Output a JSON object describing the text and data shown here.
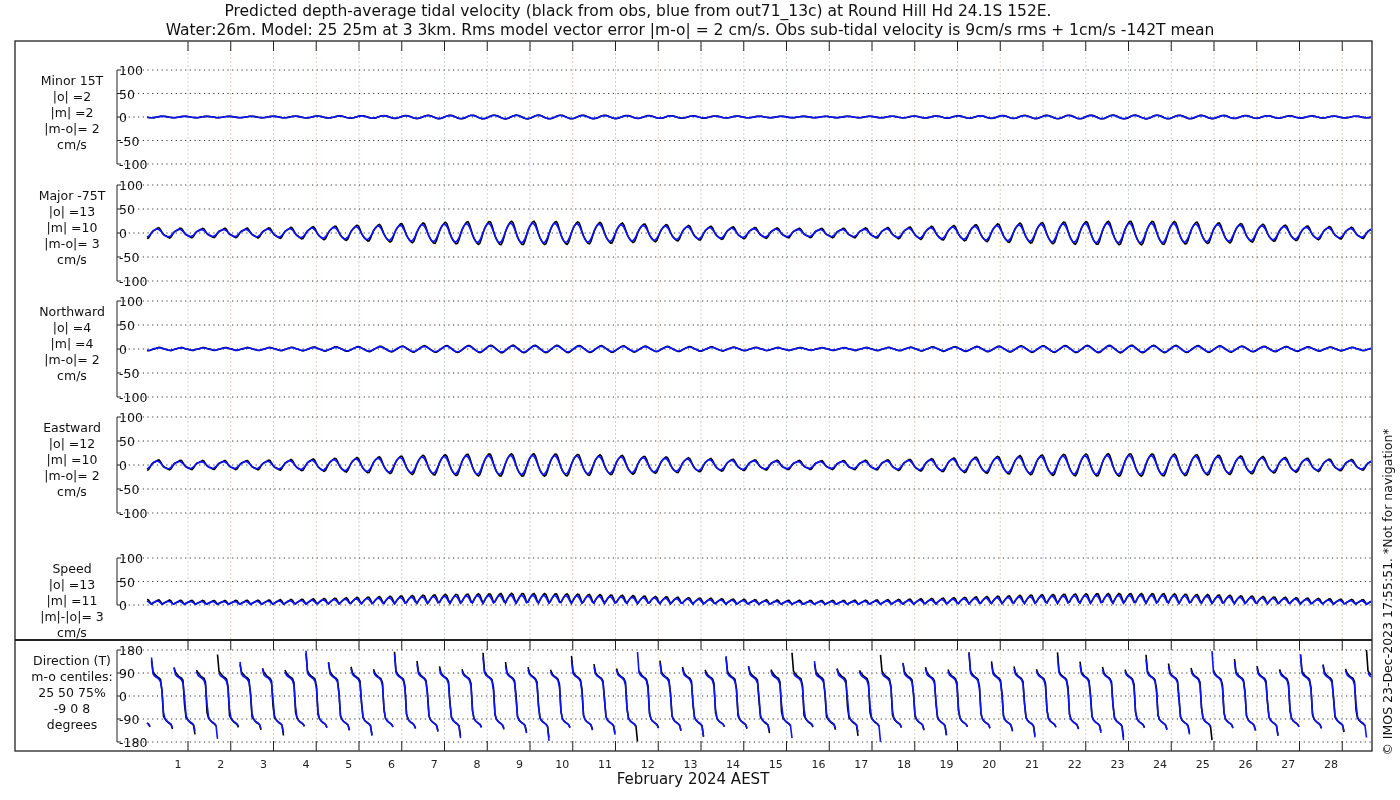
{
  "title_lines": [
    "Predicted depth-average tidal velocity (black from obs, blue from out71_13c) at Round Hill Hd 24.1S 152E.",
    "Water:26m. Model: 25 25m at 3 3km. Rms model vector error |m-o| = 2 cm/s. Obs sub-tidal velocity is 9cm/s rms + 1cm/s -142T mean"
  ],
  "panels": [
    {
      "kind": "minor",
      "label_lines": [
        "Minor 15T",
        "|o| =2",
        "|m| =2",
        "|m-o|= 2",
        "cm/s"
      ],
      "yticks": [
        "100",
        "50",
        "0",
        "-50",
        "-100"
      ]
    },
    {
      "kind": "major",
      "label_lines": [
        "Major -75T",
        "|o| =13",
        "|m| =10",
        "|m-o|= 3",
        "cm/s"
      ],
      "yticks": [
        "100",
        "50",
        "0",
        "-50",
        "-100"
      ]
    },
    {
      "kind": "north",
      "label_lines": [
        "Northward",
        "|o| =4",
        "|m| =4",
        "|m-o|= 2",
        "cm/s"
      ],
      "yticks": [
        "100",
        "50",
        "0",
        "-50",
        "-100"
      ]
    },
    {
      "kind": "east",
      "label_lines": [
        "Eastward",
        "|o| =12",
        "|m| =10",
        "|m-o|= 2",
        "cm/s"
      ],
      "yticks": [
        "100",
        "50",
        "0",
        "-50",
        "-100"
      ]
    },
    {
      "kind": "speed",
      "label_lines": [
        "Speed",
        "|o| =13",
        "|m| =11",
        "|m|-|o|= 3",
        "cm/s"
      ],
      "yticks": [
        "100",
        "50",
        "0"
      ]
    },
    {
      "kind": "direction",
      "label_lines": [
        "Direction (T)",
        "m-o centiles:",
        "25  50  75%",
        "-9  0  8",
        "degrees"
      ],
      "yticks": [
        "180",
        "90",
        "0",
        "-90",
        "-180"
      ]
    }
  ],
  "x_labels": [
    "1",
    "2",
    "3",
    "4",
    "5",
    "6",
    "7",
    "8",
    "9",
    "10",
    "11",
    "12",
    "13",
    "14",
    "15",
    "16",
    "17",
    "18",
    "19",
    "20",
    "21",
    "22",
    "23",
    "24",
    "25",
    "26",
    "27",
    "28"
  ],
  "xlabel": "February 2024 AEST",
  "credit": "© IMOS 23-Dec-2023 17:55:51. *Not for navigation*"
}
